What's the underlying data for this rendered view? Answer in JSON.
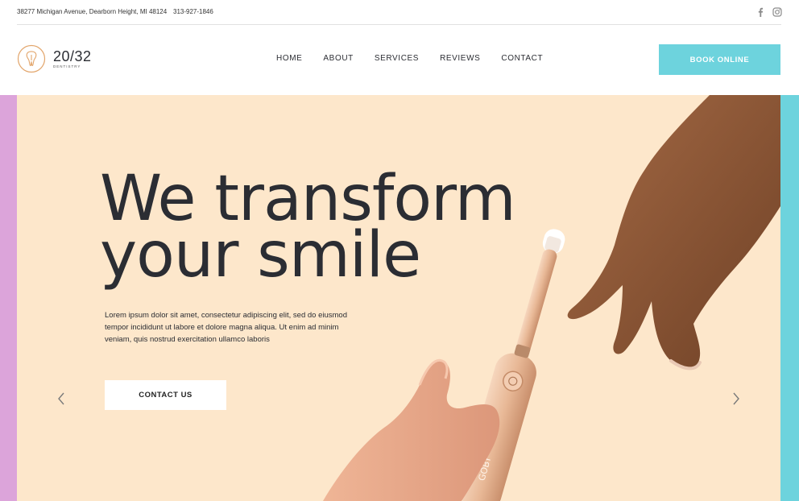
{
  "topbar": {
    "address": "38277 Michigan Avenue, Dearborn Height, MI 48124",
    "phone": "313-927-1846",
    "social_icons": [
      "facebook-icon",
      "instagram-icon"
    ]
  },
  "brand": {
    "title": "20/32",
    "subtitle": "DENTISTRY"
  },
  "nav": {
    "items": [
      {
        "label": "HOME"
      },
      {
        "label": "ABOUT"
      },
      {
        "label": "SERVICES"
      },
      {
        "label": "REVIEWS"
      },
      {
        "label": "CONTACT"
      }
    ],
    "book_label": "BOOK ONLINE"
  },
  "hero": {
    "headline_line1": "We transform",
    "headline_line2": "your smile",
    "body": "Lorem ipsum dolor sit amet, consectetur adipiscing elit, sed do eiusmod tempor incididunt ut labore et dolore magna aliqua. Ut enim ad minim veniam, quis nostrud exercitation ullamco laboris",
    "cta_label": "CONTACT US",
    "brush_brand": "GOBY"
  },
  "colors": {
    "accent_teal": "#6dd3dd",
    "accent_pink": "#dca4da",
    "hero_bg": "#fde7cb",
    "text_dark": "#2b2d33",
    "logo_orange": "#e2a56b"
  },
  "icons": [
    "tooth-logo-icon",
    "chevron-left-icon",
    "chevron-right-icon"
  ]
}
